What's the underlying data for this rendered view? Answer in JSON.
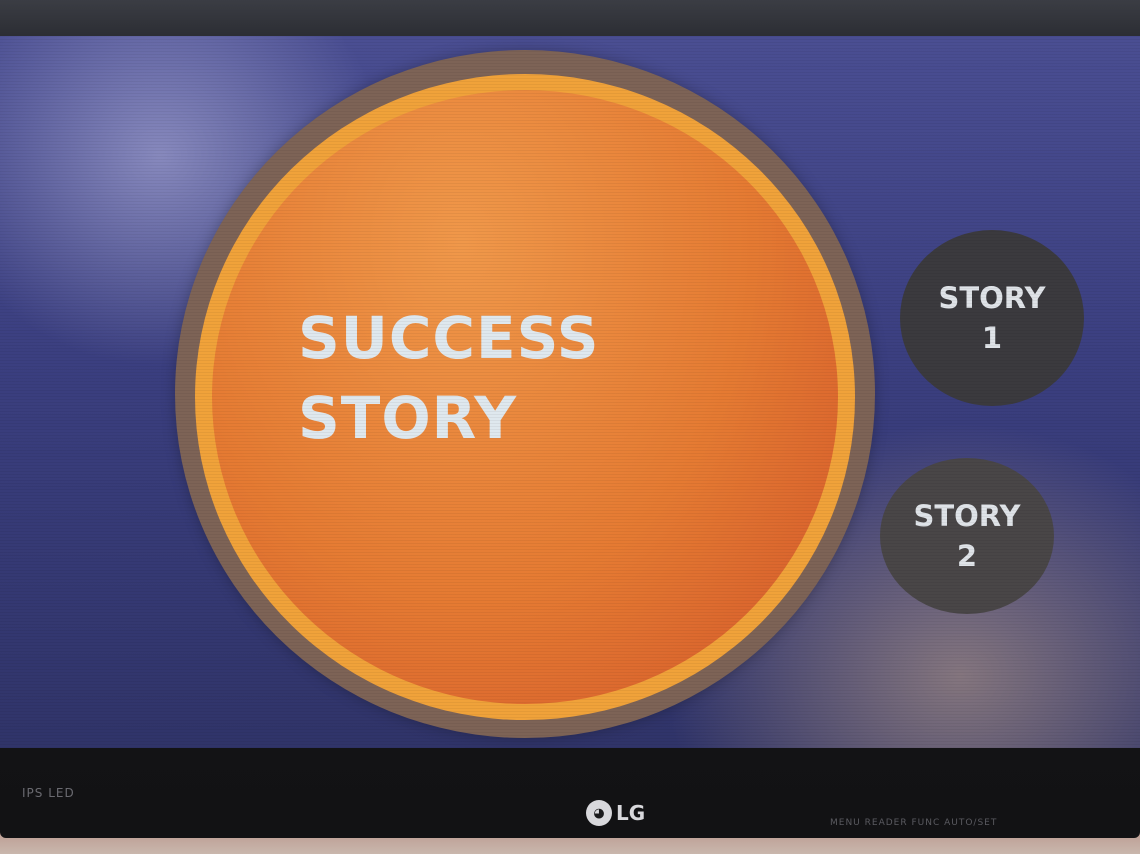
{
  "slide": {
    "title_line1": "SUCCESS",
    "title_line2": "STORY",
    "stories": [
      {
        "line1": "STORY",
        "line2": "1"
      },
      {
        "line1": "STORY",
        "line2": "2"
      }
    ]
  },
  "monitor": {
    "badge": "IPS LED",
    "brand": "LG",
    "controls": "MENU  READER  FUNC  AUTO/SET"
  },
  "colors": {
    "background": "#3b3f80",
    "circle_orange": "#e57a32",
    "circle_ring": "#f0a23a",
    "story_button": "#3b3a3e",
    "text": "#dfe8ee"
  }
}
